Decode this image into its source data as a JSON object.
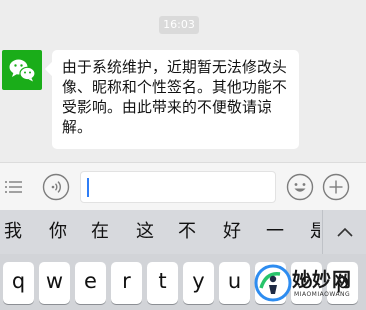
{
  "chat": {
    "timestamp": "16:03",
    "message": "由于系统维护，近期暂无法修改头像、昵称和个性签名。其他功能不受影响。由此带来的不便敬请谅解。",
    "avatar_icon": "wechat-logo-icon"
  },
  "input_bar": {
    "menu_icon": "menu-icon",
    "voice_icon": "voice-icon",
    "text_value": "",
    "emoji_icon": "emoji-icon",
    "plus_icon": "plus-icon"
  },
  "candidates": [
    "我",
    "你",
    "在",
    "这",
    "不",
    "好",
    "一",
    "是"
  ],
  "candidate_collapse_icon": "chevron-up-icon",
  "keys": [
    "q",
    "w",
    "e",
    "r",
    "t",
    "y",
    "u",
    "i",
    "o",
    "p"
  ],
  "watermark": {
    "title": "妙妙网",
    "subtitle": "MIAOMIAOWANG"
  },
  "colors": {
    "chat_background": "#ededed",
    "wechat_green": "#1aad19",
    "bubble": "#ffffff",
    "keyboard_background": "#d2d4d8",
    "cursor": "#2f7ef6"
  }
}
